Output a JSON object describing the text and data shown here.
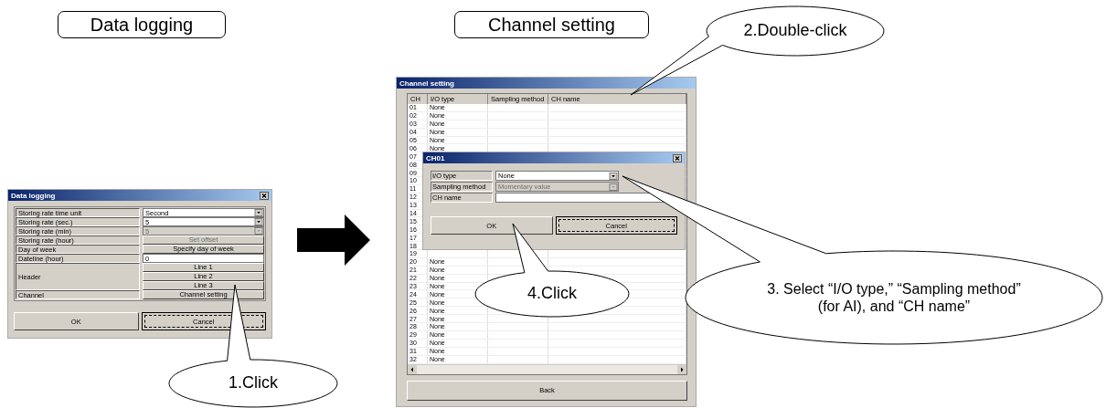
{
  "data_logging": {
    "step_label": "Data logging",
    "title": "Data logging",
    "rows": [
      {
        "label": "Storing rate time unit",
        "kind": "dropdown",
        "value": "Second",
        "disabled": false
      },
      {
        "label": "Storing rate (sec.)",
        "kind": "dropdown",
        "value": "5",
        "disabled": false
      },
      {
        "label": "Storing rate (min)",
        "kind": "dropdown",
        "value": "5",
        "disabled": true
      },
      {
        "label": "Storing rate (hour)",
        "kind": "button",
        "buttons": [
          "Set offset"
        ],
        "disabled": true
      },
      {
        "label": "Day of week",
        "kind": "button",
        "buttons": [
          "Specify day of week"
        ],
        "disabled": false
      },
      {
        "label": "Dateline (hour)",
        "kind": "input",
        "value": "0"
      },
      {
        "label": "Header",
        "kind": "button",
        "buttons": [
          "Line 1",
          "Line 2",
          "Line 3"
        ],
        "disabled": false
      },
      {
        "label": "Channel",
        "kind": "button",
        "buttons": [
          "Channel setting"
        ],
        "disabled": false
      }
    ],
    "buttons": [
      {
        "label": "OK",
        "focused": false
      },
      {
        "label": "Cancel",
        "focused": true
      }
    ]
  },
  "channel_setting": {
    "step_label": "Channel setting",
    "title": "Channel setting",
    "columns": [
      "CH",
      "I/O type",
      "Sampling method",
      "CH name"
    ],
    "rows": [
      {
        "ch": "01",
        "io_type": "None"
      },
      {
        "ch": "02",
        "io_type": "None"
      },
      {
        "ch": "03",
        "io_type": "None"
      },
      {
        "ch": "04",
        "io_type": "None"
      },
      {
        "ch": "05",
        "io_type": "None"
      },
      {
        "ch": "06",
        "io_type": "None"
      },
      {
        "ch": "07"
      },
      {
        "ch": "08"
      },
      {
        "ch": "09"
      },
      {
        "ch": "10"
      },
      {
        "ch": "11"
      },
      {
        "ch": "12"
      },
      {
        "ch": "13"
      },
      {
        "ch": "14"
      },
      {
        "ch": "15"
      },
      {
        "ch": "16"
      },
      {
        "ch": "17"
      },
      {
        "ch": "18"
      },
      {
        "ch": "19"
      },
      {
        "ch": "20",
        "io_type": "None"
      },
      {
        "ch": "21",
        "io_type": "None"
      },
      {
        "ch": "22",
        "io_type": "None"
      },
      {
        "ch": "23",
        "io_type": "None"
      },
      {
        "ch": "24",
        "io_type": "None"
      },
      {
        "ch": "25",
        "io_type": "None"
      },
      {
        "ch": "26",
        "io_type": "None"
      },
      {
        "ch": "27",
        "io_type": "None"
      },
      {
        "ch": "28",
        "io_type": "None"
      },
      {
        "ch": "29",
        "io_type": "None"
      },
      {
        "ch": "30",
        "io_type": "None"
      },
      {
        "ch": "31",
        "io_type": "None"
      },
      {
        "ch": "32",
        "io_type": "None"
      }
    ],
    "back_button": "Back"
  },
  "ch_dialog": {
    "title": "CH01",
    "fields": [
      {
        "label": "I/O type",
        "kind": "dropdown",
        "value": "None",
        "disabled": false
      },
      {
        "label": "Sampling method",
        "kind": "dropdown",
        "value": "Momentary value",
        "disabled": true
      },
      {
        "label": "CH name",
        "kind": "input"
      }
    ],
    "buttons": [
      {
        "label": "OK",
        "focused": false
      },
      {
        "label": "Cancel",
        "focused": true
      }
    ]
  },
  "callouts": [
    {
      "lines": [
        "2.Double-click"
      ]
    },
    {
      "lines": [
        "4.Click"
      ]
    },
    {
      "lines": [
        "3. Select  “I/O type,” “Sampling method”",
        "(for AI), and “CH name”"
      ]
    },
    {
      "lines": [
        "1.Click"
      ]
    }
  ]
}
